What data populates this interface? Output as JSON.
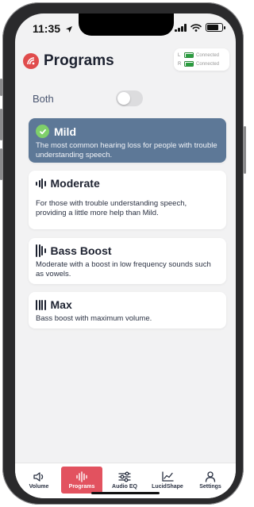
{
  "status_bar": {
    "time": "11:35"
  },
  "header": {
    "title": "Programs"
  },
  "connection": {
    "left": {
      "side": "L",
      "status": "Connected"
    },
    "right": {
      "side": "R",
      "status": "Connected"
    }
  },
  "both": {
    "label": "Both",
    "toggle_on": false
  },
  "programs": [
    {
      "title": "Mild",
      "description": "The most common hearing loss for people with trouble understanding speech.",
      "selected": true,
      "icon": "check-icon"
    },
    {
      "title": "Moderate",
      "description": "For those with trouble understanding speech, providing a little more help than Mild.",
      "selected": false,
      "icon": "moderate-bars-icon"
    },
    {
      "title": "Bass Boost",
      "description": "Moderate with a boost in low frequency sounds such as vowels.",
      "selected": false,
      "icon": "bass-bars-icon"
    },
    {
      "title": "Max",
      "description": "Bass boost with maximum volume.",
      "selected": false,
      "icon": "max-bars-icon"
    }
  ],
  "tabs": [
    {
      "label": "Volume",
      "icon": "speaker-icon",
      "active": false
    },
    {
      "label": "Programs",
      "icon": "waveform-icon",
      "active": true
    },
    {
      "label": "Audio EQ",
      "icon": "sliders-icon",
      "active": false
    },
    {
      "label": "LucidShape",
      "icon": "chart-icon",
      "active": false
    },
    {
      "label": "Settings",
      "icon": "person-icon",
      "active": false
    }
  ],
  "colors": {
    "accent_red": "#e2525f",
    "selected_card": "#5d7897",
    "check_green": "#7fcf6a",
    "battery_green": "#2a9d3f"
  }
}
